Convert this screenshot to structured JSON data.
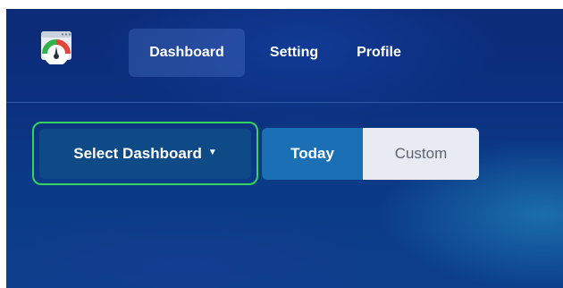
{
  "nav": {
    "logo_icon": "speedometer-browser-icon",
    "items": [
      {
        "label": "Dashboard",
        "active": true
      },
      {
        "label": "Setting",
        "active": false
      },
      {
        "label": "Profile",
        "active": false
      }
    ]
  },
  "controls": {
    "select_dashboard_label": "Select Dashboard",
    "caret_icon": "caret-down-icon",
    "range_options": [
      {
        "label": "Today",
        "selected": true
      },
      {
        "label": "Custom",
        "selected": false
      }
    ]
  },
  "colors": {
    "focus_outline": "#35d45a",
    "button_primary": "#0d4a86",
    "segment_active": "#1a6fb5",
    "segment_inactive": "#e8ebf2"
  }
}
